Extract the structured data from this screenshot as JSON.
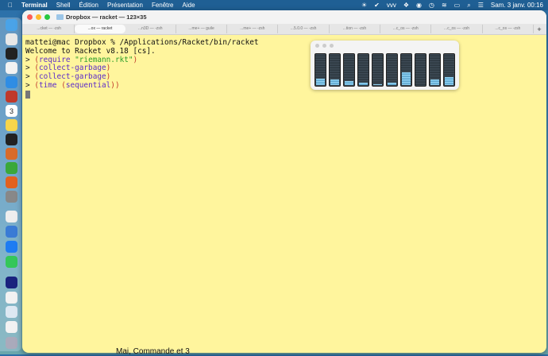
{
  "menubar": {
    "app": "Terminal",
    "items": [
      "Shell",
      "Édition",
      "Présentation",
      "Fenêtre",
      "Aide"
    ],
    "clock": "Sam. 3 janv.  00:16"
  },
  "dock": {
    "items": [
      "finder",
      "launchpad",
      "activity-monitor",
      "reminders",
      "safari",
      "racket",
      "calendar",
      "notes",
      "terminal",
      "game",
      "vim",
      "firefox",
      "system-settings",
      "textedit",
      "scanner",
      "app-store",
      "messages",
      "screen",
      "document1",
      "document2",
      "document3",
      "trash"
    ],
    "calendar_day": "3"
  },
  "window": {
    "title": "Dropbox — racket — 123×35",
    "tabs": [
      "...cket — -zsh",
      "...ox — racket",
      "...n3D — -zsh",
      "...me+ — guile",
      "...me+ — -zsh",
      "...5.0.0 — -zsh",
      "...tion — -zsh",
      "...c_os — -zsh",
      "...c_os — -zsh",
      "...c_os — -zsh"
    ],
    "active_tab": 1,
    "new_tab": "+"
  },
  "terminal": {
    "line1": "mattei@mac Dropbox % /Applications/Racket/bin/racket",
    "line2": "Welcome to Racket v8.18 [cs].",
    "prompt": ">",
    "cmd1": {
      "open": "(",
      "kw": "require",
      "str": "\"riemann.rkt\"",
      "close": ")"
    },
    "cmd2": {
      "open": "(",
      "kw": "collect-garbage",
      "close": ")"
    },
    "cmd3": {
      "open": "(",
      "kw": "collect-garbage",
      "close": ")"
    },
    "cmd4": {
      "open1": "(",
      "kw1": "time",
      "open2": " (",
      "kw2": "sequential",
      "close": "))"
    }
  },
  "cpu_meter": {
    "core_loads": [
      0.2,
      0.17,
      0.12,
      0.08,
      0.03,
      0.08,
      0.4,
      0.0,
      0.17,
      0.25
    ]
  },
  "background_text": "Mai, Commande et 3"
}
